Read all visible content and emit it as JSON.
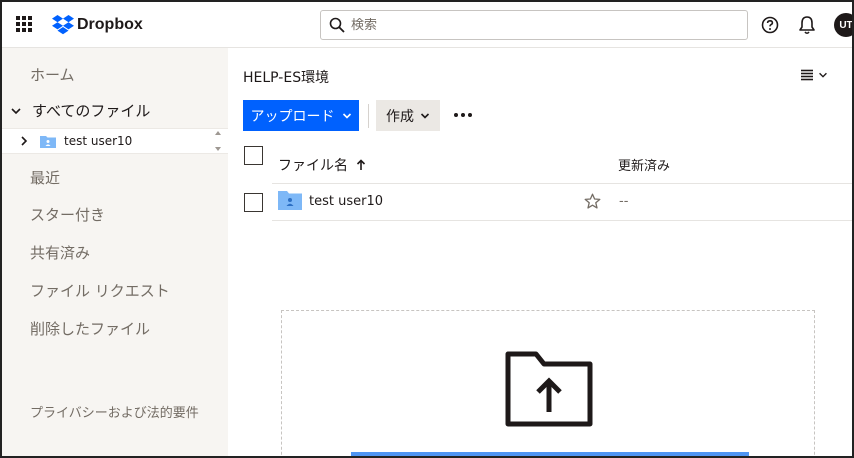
{
  "topbar": {
    "brand": "Dropbox",
    "search_placeholder": "検索",
    "avatar_initials": "UT"
  },
  "sidebar": {
    "home": "ホーム",
    "all_files": "すべてのファイル",
    "tree_item": "test user10",
    "recent": "最近",
    "starred": "スター付き",
    "shared": "共有済み",
    "file_requests": "ファイル リクエスト",
    "deleted_files": "削除したファイル",
    "privacy": "プライバシーおよび法的要件"
  },
  "main": {
    "title": "HELP-ES環境",
    "upload_label": "アップロード",
    "create_label": "作成",
    "columns": {
      "name": "ファイル名",
      "modified": "更新済み"
    },
    "rows": [
      {
        "name": "test user10",
        "modified": "--"
      }
    ]
  },
  "colors": {
    "accent": "#0061fe",
    "sidebar_bg": "#f7f5f2",
    "folder": "#7eb8f7"
  }
}
